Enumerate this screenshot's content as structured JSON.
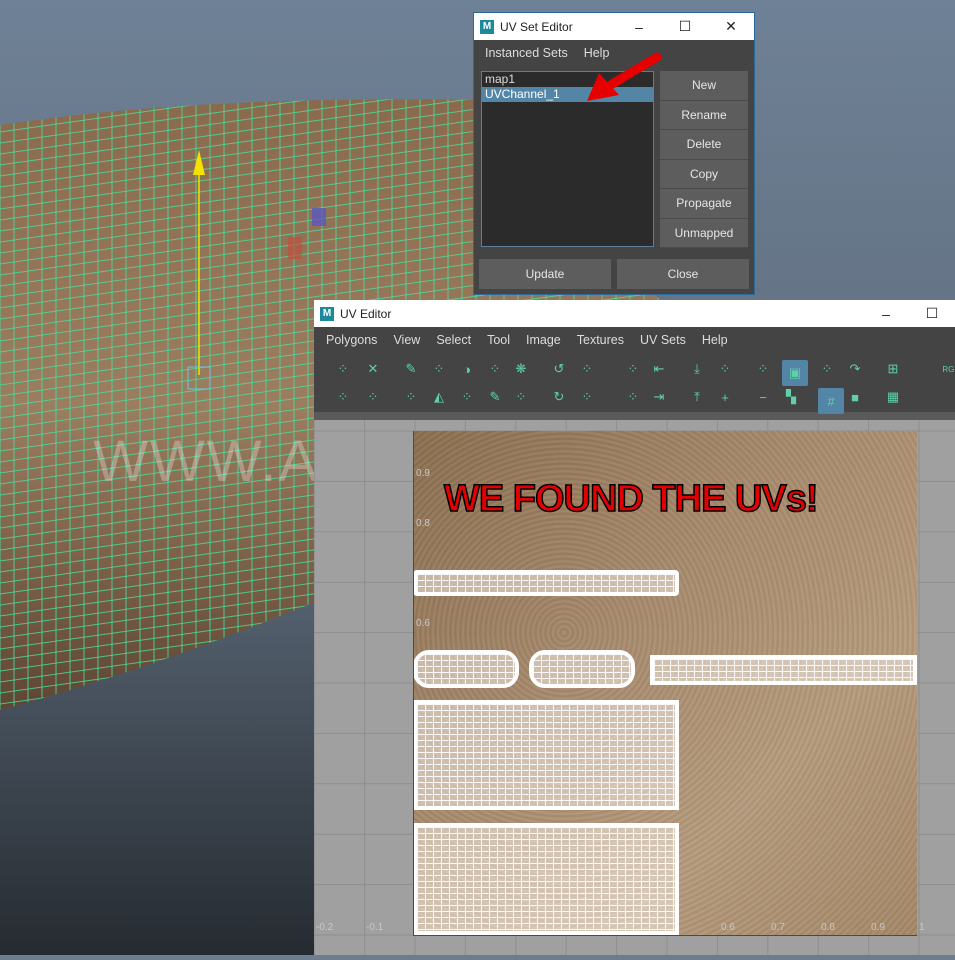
{
  "watermark": "WWW.ANTONIOBOSI.COM",
  "annotation": "WE FOUND THE UVs!",
  "uv_set_editor": {
    "title": "UV Set Editor",
    "menu": [
      "Instanced Sets",
      "Help"
    ],
    "sets": [
      "map1",
      "UVChannel_1"
    ],
    "selected_set": "UVChannel_1",
    "buttons": [
      "New",
      "Rename",
      "Delete",
      "Copy",
      "Propagate",
      "Unmapped"
    ],
    "update_label": "Update",
    "close_label": "Close",
    "arrow_color": "#e60000"
  },
  "uv_editor": {
    "title": "UV Editor",
    "menu": [
      "Polygons",
      "View",
      "Select",
      "Tool",
      "Image",
      "Textures",
      "UV Sets",
      "Help"
    ],
    "tools": [
      "grid-select",
      "transform",
      "cut-uv",
      "cut-edge",
      "sew",
      "move-sew",
      "unfold-toggle",
      "flip-u",
      "flip-v",
      "symmetrize",
      "tweak-select",
      "lasso",
      "smear",
      "layout",
      "rotate-ccw",
      "rotate-cw",
      "straighten-toggle",
      "align-grid",
      "distribute",
      "stack",
      "align-left",
      "align-right",
      "align-bottom",
      "align-top",
      "grow-select",
      "grow",
      "select-shell",
      "shrink",
      "image-display",
      "checker-filter",
      "dim-image",
      "snap-grid",
      "pixel-snap",
      "color-display",
      "grid-display",
      "checker",
      "rgb"
    ],
    "axis_u_labels": [
      "-0.2",
      "-0.1",
      "0.6",
      "0.7",
      "0.8",
      "0.9",
      "1"
    ],
    "axis_v_labels": [
      "0.9",
      "0.8",
      "0.6"
    ]
  }
}
